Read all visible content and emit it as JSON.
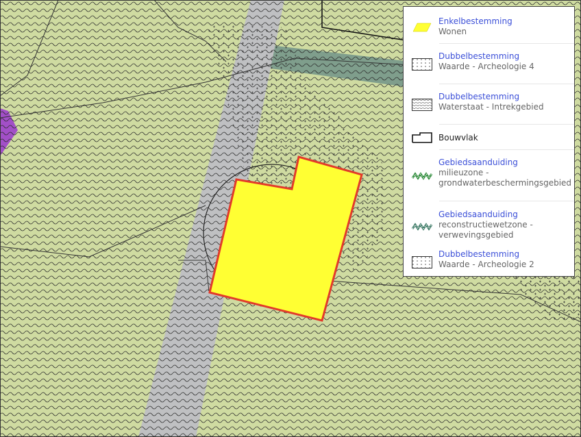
{
  "map": {
    "colors": {
      "agri": "#cfdba1",
      "road": "#bfc0c2",
      "water": "#7f9e8c",
      "purple": "#a24fc7",
      "plot": "#ffff33",
      "plot_outline": "#e23a2a"
    }
  },
  "legend": {
    "items": [
      {
        "category": "Enkelbestemming",
        "subtitle": "Wonen",
        "symbol": "yellow-parallelogram-icon"
      },
      {
        "category": "Dubbelbestemming",
        "subtitle": "Waarde - Archeologie 4",
        "symbol": "dotted-box-icon"
      },
      {
        "category": "Dubbelbestemming",
        "subtitle": "Waterstaat - Intrekgebied",
        "symbol": "wavy-box-icon"
      },
      {
        "label": "Bouwvlak",
        "symbol": "building-outline-icon"
      },
      {
        "category": "Gebiedsaanduiding",
        "subtitle_lines": [
          "milieuzone -",
          "grondwaterbeschermingsgebied"
        ],
        "symbol": "green-zigzag-icon"
      },
      {
        "category": "Gebiedsaanduiding",
        "subtitle_lines": [
          "reconstructiewetzone -",
          "verwevingsgebied"
        ],
        "symbol": "teal-zigzag-icon"
      },
      {
        "category": "Dubbelbestemming",
        "subtitle": "Waarde - Archeologie 2",
        "symbol": "dotted-box-icon"
      }
    ]
  }
}
